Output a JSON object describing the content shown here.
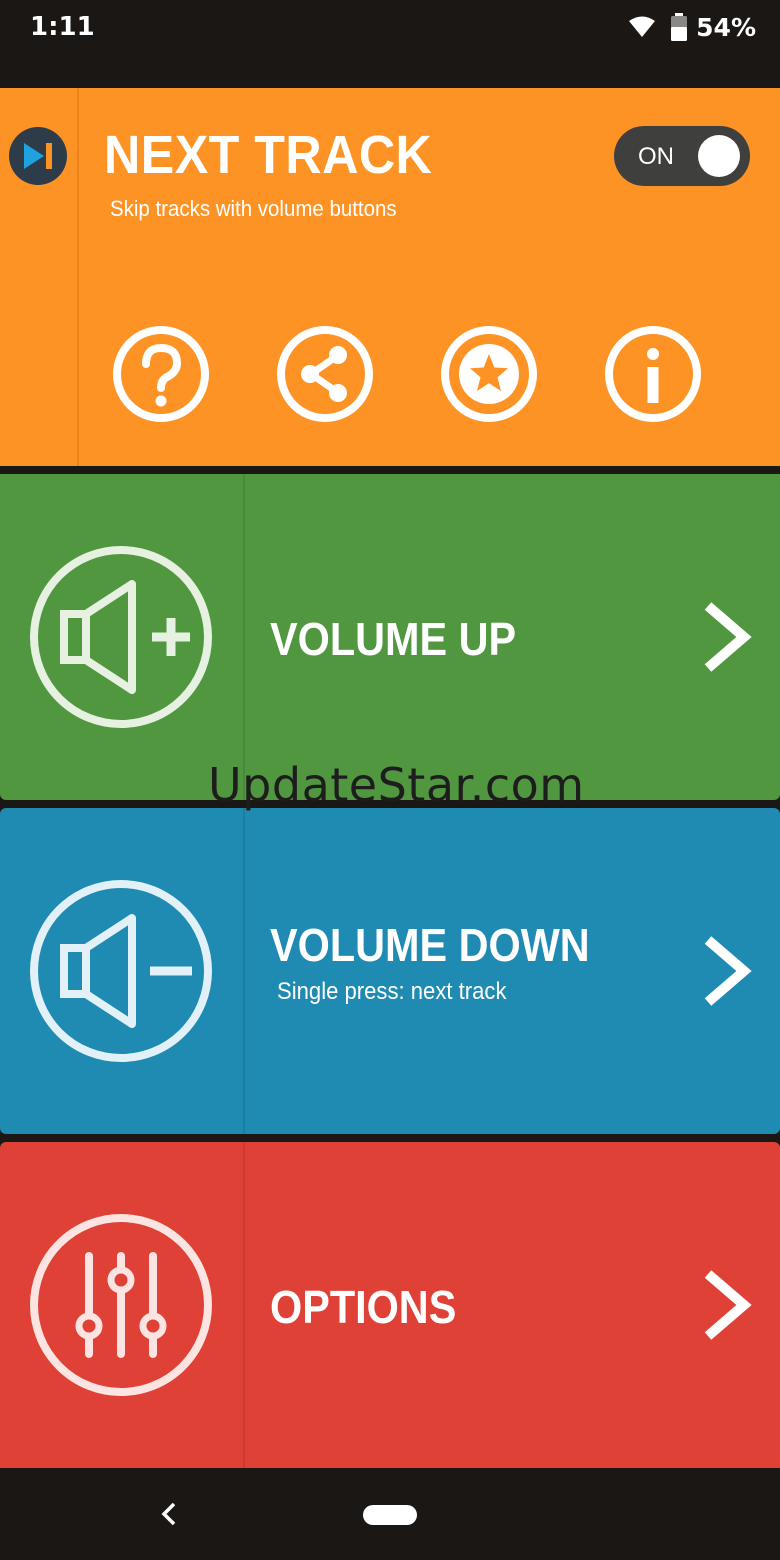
{
  "status_bar": {
    "time": "1:11",
    "battery_percent_label": "54%",
    "icons": [
      "wifi-icon",
      "battery-icon"
    ]
  },
  "header": {
    "title": "NEXT TRACK",
    "subtitle": "Skip tracks with volume buttons",
    "toggle": {
      "label": "ON",
      "state": true
    },
    "icon_buttons": [
      "help-icon",
      "share-icon",
      "star-icon",
      "info-icon"
    ],
    "color": "#fd9325"
  },
  "panels": {
    "volume_up": {
      "title": "VOLUME UP",
      "icon": "volume-up-icon",
      "color": "#519740"
    },
    "volume_down": {
      "title": "VOLUME DOWN",
      "subtitle": "Single press: next track",
      "icon": "volume-down-icon",
      "color": "#1f8bb2"
    },
    "options": {
      "title": "OPTIONS",
      "icon": "sliders-icon",
      "color": "#e04136"
    }
  },
  "watermark": "UpdateStar.com",
  "nav_bar": {
    "icons": [
      "back-icon",
      "home-pill-icon"
    ]
  }
}
